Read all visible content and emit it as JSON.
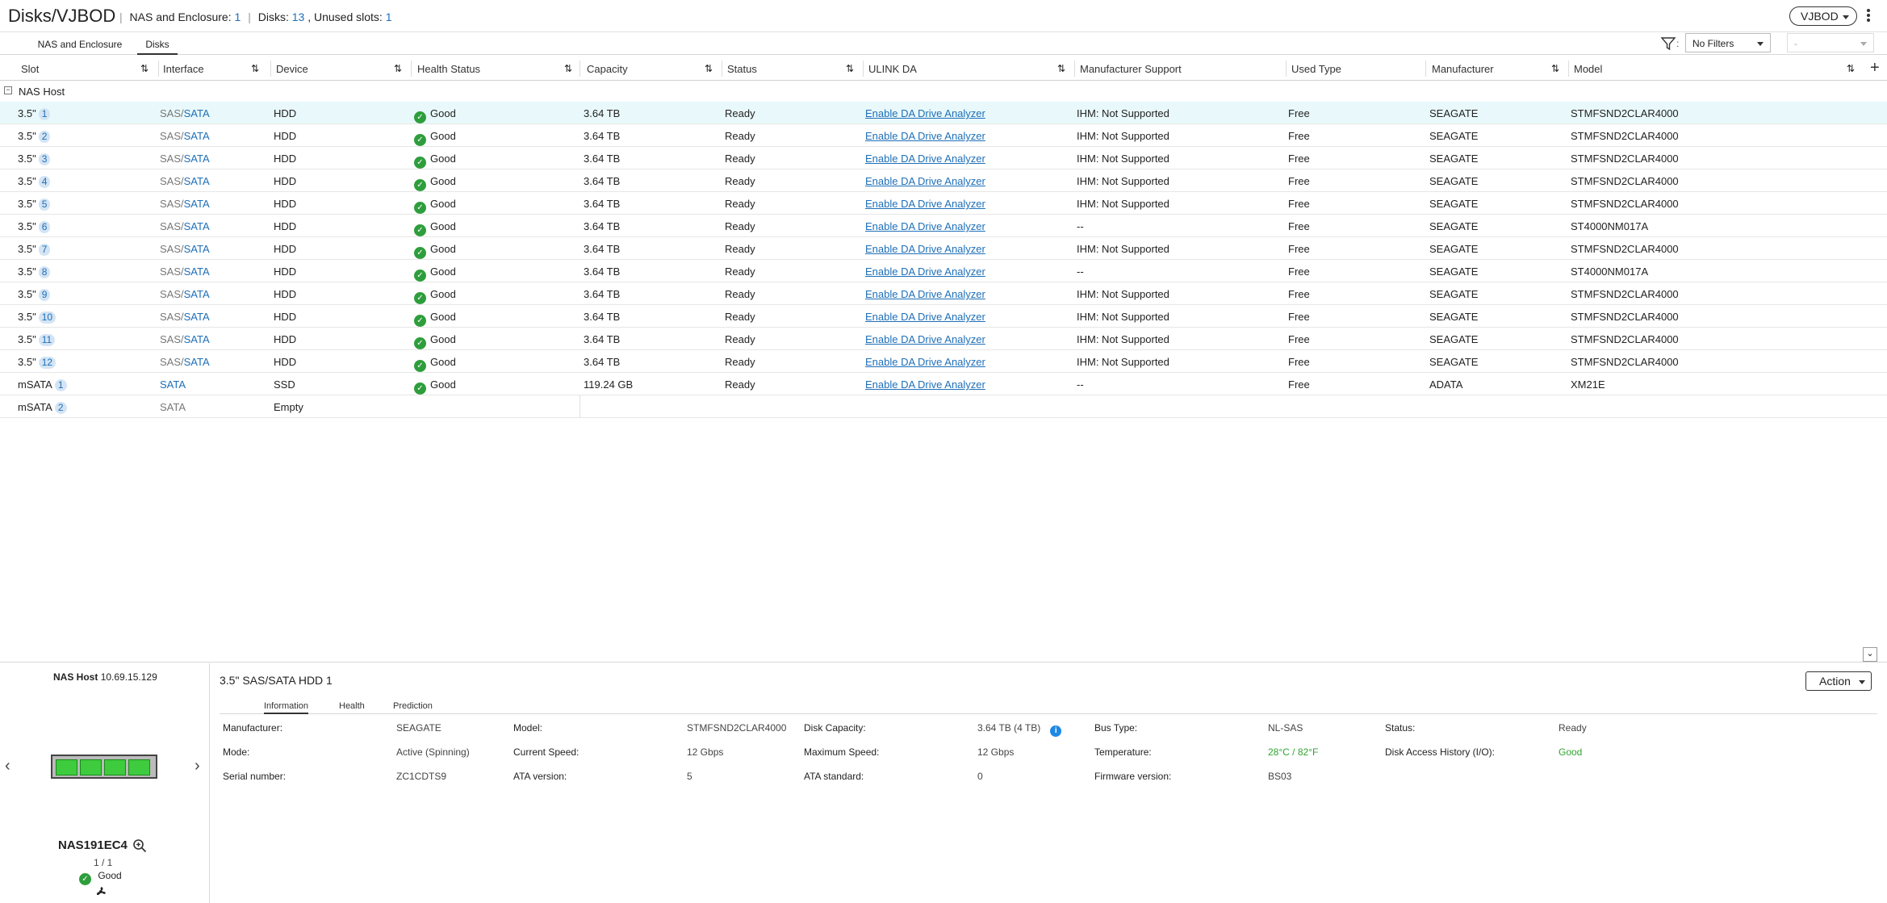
{
  "header": {
    "title": "Disks/VJBOD",
    "nas_label": "NAS and Enclosure:",
    "nas_count": "1",
    "disks_label": "Disks:",
    "disks_count": "13",
    "unused_label": ", Unused slots:",
    "unused_count": "1",
    "vjbod_button": "VJBOD"
  },
  "tabs": [
    {
      "label": "NAS and Enclosure",
      "active": false
    },
    {
      "label": "Disks",
      "active": true
    }
  ],
  "filters": {
    "primary": "No Filters",
    "secondary": "-"
  },
  "columns": [
    "Slot",
    "Interface",
    "Device",
    "Health Status",
    "Capacity",
    "Status",
    "ULINK DA",
    "Manufacturer Support",
    "Used Type",
    "Manufacturer",
    "Model"
  ],
  "group_label": "NAS Host",
  "rows": [
    {
      "slot": "3.5\"",
      "num": "1",
      "sas": "SAS",
      "sata": "SATA",
      "device": "HDD",
      "health": "Good",
      "capacity": "3.64 TB",
      "status": "Ready",
      "ulink": "Enable DA Drive Analyzer",
      "support": "IHM: Not Supported",
      "used": "Free",
      "mfr": "SEAGATE",
      "model": "STMFSND2CLAR4000"
    },
    {
      "slot": "3.5\"",
      "num": "2",
      "sas": "SAS",
      "sata": "SATA",
      "device": "HDD",
      "health": "Good",
      "capacity": "3.64 TB",
      "status": "Ready",
      "ulink": "Enable DA Drive Analyzer",
      "support": "IHM: Not Supported",
      "used": "Free",
      "mfr": "SEAGATE",
      "model": "STMFSND2CLAR4000"
    },
    {
      "slot": "3.5\"",
      "num": "3",
      "sas": "SAS",
      "sata": "SATA",
      "device": "HDD",
      "health": "Good",
      "capacity": "3.64 TB",
      "status": "Ready",
      "ulink": "Enable DA Drive Analyzer",
      "support": "IHM: Not Supported",
      "used": "Free",
      "mfr": "SEAGATE",
      "model": "STMFSND2CLAR4000"
    },
    {
      "slot": "3.5\"",
      "num": "4",
      "sas": "SAS",
      "sata": "SATA",
      "device": "HDD",
      "health": "Good",
      "capacity": "3.64 TB",
      "status": "Ready",
      "ulink": "Enable DA Drive Analyzer",
      "support": "IHM: Not Supported",
      "used": "Free",
      "mfr": "SEAGATE",
      "model": "STMFSND2CLAR4000"
    },
    {
      "slot": "3.5\"",
      "num": "5",
      "sas": "SAS",
      "sata": "SATA",
      "device": "HDD",
      "health": "Good",
      "capacity": "3.64 TB",
      "status": "Ready",
      "ulink": "Enable DA Drive Analyzer",
      "support": "IHM: Not Supported",
      "used": "Free",
      "mfr": "SEAGATE",
      "model": "STMFSND2CLAR4000"
    },
    {
      "slot": "3.5\"",
      "num": "6",
      "sas": "SAS",
      "sata": "SATA",
      "device": "HDD",
      "health": "Good",
      "capacity": "3.64 TB",
      "status": "Ready",
      "ulink": "Enable DA Drive Analyzer",
      "support": "--",
      "used": "Free",
      "mfr": "SEAGATE",
      "model": "ST4000NM017A"
    },
    {
      "slot": "3.5\"",
      "num": "7",
      "sas": "SAS",
      "sata": "SATA",
      "device": "HDD",
      "health": "Good",
      "capacity": "3.64 TB",
      "status": "Ready",
      "ulink": "Enable DA Drive Analyzer",
      "support": "IHM: Not Supported",
      "used": "Free",
      "mfr": "SEAGATE",
      "model": "STMFSND2CLAR4000"
    },
    {
      "slot": "3.5\"",
      "num": "8",
      "sas": "SAS",
      "sata": "SATA",
      "device": "HDD",
      "health": "Good",
      "capacity": "3.64 TB",
      "status": "Ready",
      "ulink": "Enable DA Drive Analyzer",
      "support": "--",
      "used": "Free",
      "mfr": "SEAGATE",
      "model": "ST4000NM017A"
    },
    {
      "slot": "3.5\"",
      "num": "9",
      "sas": "SAS",
      "sata": "SATA",
      "device": "HDD",
      "health": "Good",
      "capacity": "3.64 TB",
      "status": "Ready",
      "ulink": "Enable DA Drive Analyzer",
      "support": "IHM: Not Supported",
      "used": "Free",
      "mfr": "SEAGATE",
      "model": "STMFSND2CLAR4000"
    },
    {
      "slot": "3.5\"",
      "num": "10",
      "sas": "SAS",
      "sata": "SATA",
      "device": "HDD",
      "health": "Good",
      "capacity": "3.64 TB",
      "status": "Ready",
      "ulink": "Enable DA Drive Analyzer",
      "support": "IHM: Not Supported",
      "used": "Free",
      "mfr": "SEAGATE",
      "model": "STMFSND2CLAR4000"
    },
    {
      "slot": "3.5\"",
      "num": "11",
      "sas": "SAS",
      "sata": "SATA",
      "device": "HDD",
      "health": "Good",
      "capacity": "3.64 TB",
      "status": "Ready",
      "ulink": "Enable DA Drive Analyzer",
      "support": "IHM: Not Supported",
      "used": "Free",
      "mfr": "SEAGATE",
      "model": "STMFSND2CLAR4000"
    },
    {
      "slot": "3.5\"",
      "num": "12",
      "sas": "SAS",
      "sata": "SATA",
      "device": "HDD",
      "health": "Good",
      "capacity": "3.64 TB",
      "status": "Ready",
      "ulink": "Enable DA Drive Analyzer",
      "support": "IHM: Not Supported",
      "used": "Free",
      "mfr": "SEAGATE",
      "model": "STMFSND2CLAR4000"
    },
    {
      "slot": "mSATA",
      "num": "1",
      "sas": "",
      "sata": "SATA",
      "device": "SSD",
      "health": "Good",
      "capacity": "119.24 GB",
      "status": "Ready",
      "ulink": "Enable DA Drive Analyzer",
      "support": "--",
      "used": "Free",
      "mfr": "ADATA",
      "model": "XM21E"
    },
    {
      "slot": "mSATA",
      "num": "2",
      "sas": "",
      "sata": "SATA",
      "device": "Empty",
      "health": "",
      "capacity": "",
      "status": "",
      "ulink": "",
      "support": "",
      "used": "",
      "mfr": "",
      "model": ""
    }
  ],
  "left_pane": {
    "host_label": "NAS Host",
    "host_ip": "10.69.15.129",
    "device_name": "NAS191EC4",
    "count": "1 / 1",
    "health": "Good"
  },
  "detail": {
    "title": "3.5\" SAS/SATA HDD 1",
    "action_button": "Action",
    "tabs": [
      "Information",
      "Health",
      "Prediction"
    ],
    "fields": [
      {
        "label": "Manufacturer:",
        "value": "SEAGATE"
      },
      {
        "label": "Model:",
        "value": "STMFSND2CLAR4000"
      },
      {
        "label": "Disk Capacity:",
        "value": "3.64 TB (4 TB)"
      },
      {
        "label": "Bus Type:",
        "value": "NL-SAS"
      },
      {
        "label": "Status:",
        "value": "Ready"
      },
      {
        "label": "Mode:",
        "value": "Active (Spinning)"
      },
      {
        "label": "Current Speed:",
        "value": "12 Gbps"
      },
      {
        "label": "Maximum Speed:",
        "value": "12 Gbps"
      },
      {
        "label": "Temperature:",
        "value": "28°C / 82°F"
      },
      {
        "label": "Disk Access History (I/O):",
        "value": "Good"
      },
      {
        "label": "Serial number:",
        "value": "ZC1CDTS9"
      },
      {
        "label": "ATA version:",
        "value": "5"
      },
      {
        "label": "ATA standard:",
        "value": "0"
      },
      {
        "label": "Firmware version:",
        "value": "BS03"
      }
    ]
  },
  "colors": {
    "accent_blue": "#1e6fb8",
    "good_green": "#2e9e3c",
    "selected_row": "#e9f9fb"
  }
}
